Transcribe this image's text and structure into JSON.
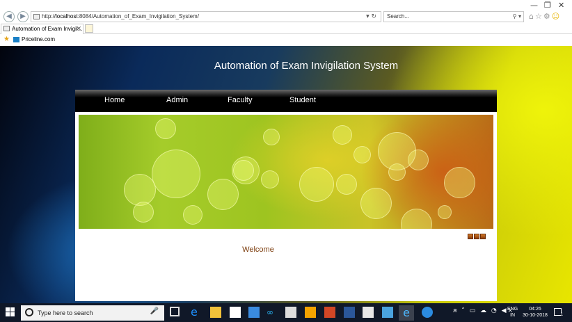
{
  "browser": {
    "window_controls": [
      "—",
      "❐",
      "✕"
    ],
    "address": {
      "prefix": "http://",
      "host": "localhost",
      "rest": ":8084/Automation_of_Exam_Invigilation_System/"
    },
    "search_placeholder": "Search...",
    "tab": {
      "title": "Automation of Exam Invigil...",
      "close": "✕"
    },
    "favorites": [
      {
        "label": "Priceline.com"
      }
    ]
  },
  "page": {
    "title": "Automation of Exam Invigilation System",
    "nav": [
      {
        "label": "Home"
      },
      {
        "label": "Admin"
      },
      {
        "label": "Faculty"
      },
      {
        "label": "Student"
      }
    ],
    "welcome": "Welcome",
    "slides": 3
  },
  "taskbar": {
    "search_placeholder": "Type here to search",
    "language": {
      "line1": "ENG",
      "line2": "IN"
    },
    "time": "04:26",
    "date": "30-10-2018",
    "notifications": "1"
  }
}
